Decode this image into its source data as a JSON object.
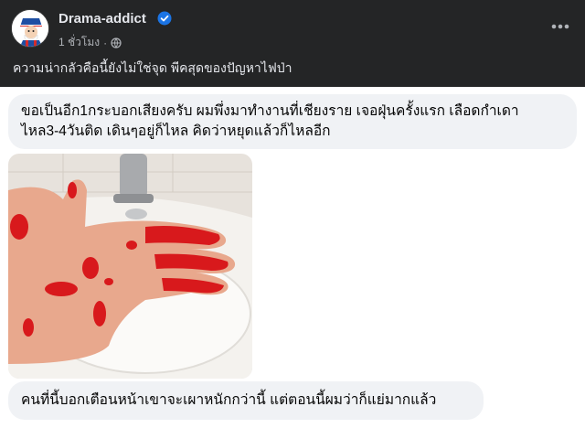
{
  "post": {
    "author": "Drama-addict",
    "time": "1 ชั่วโมง",
    "separator": "·",
    "caption": "ความน่ากลัวคือนี้ยังไม่ใช่จุด พีคสุดของปัญหาไฟป่า",
    "icons": {
      "verified": "verified-badge-icon",
      "audience": "globe-icon",
      "more": "more-options-icon"
    },
    "colors": {
      "header_bg": "#242526",
      "verified": "#1b74e4",
      "bubble_bg": "#f0f2f5"
    }
  },
  "comments": [
    {
      "text_line1": "ขอเป็นอีก1กระบอกเสียงครับ ผมพึ่งมาทำงานที่เชียงราย เจอฝุ่นครั้งแรก เลือดกำเดา",
      "text_line2": "ไหล3-4วันติด เดินๆอยู่ก็ไหล คิดว่าหยุดแล้วก็ไหลอีก"
    },
    {
      "text": "คนที่นี้บอกเตือนหน้าเขาจะเผาหนักกว่านี้ แต่ตอนนี้ผมว่าก็แย่มากแล้ว"
    }
  ]
}
